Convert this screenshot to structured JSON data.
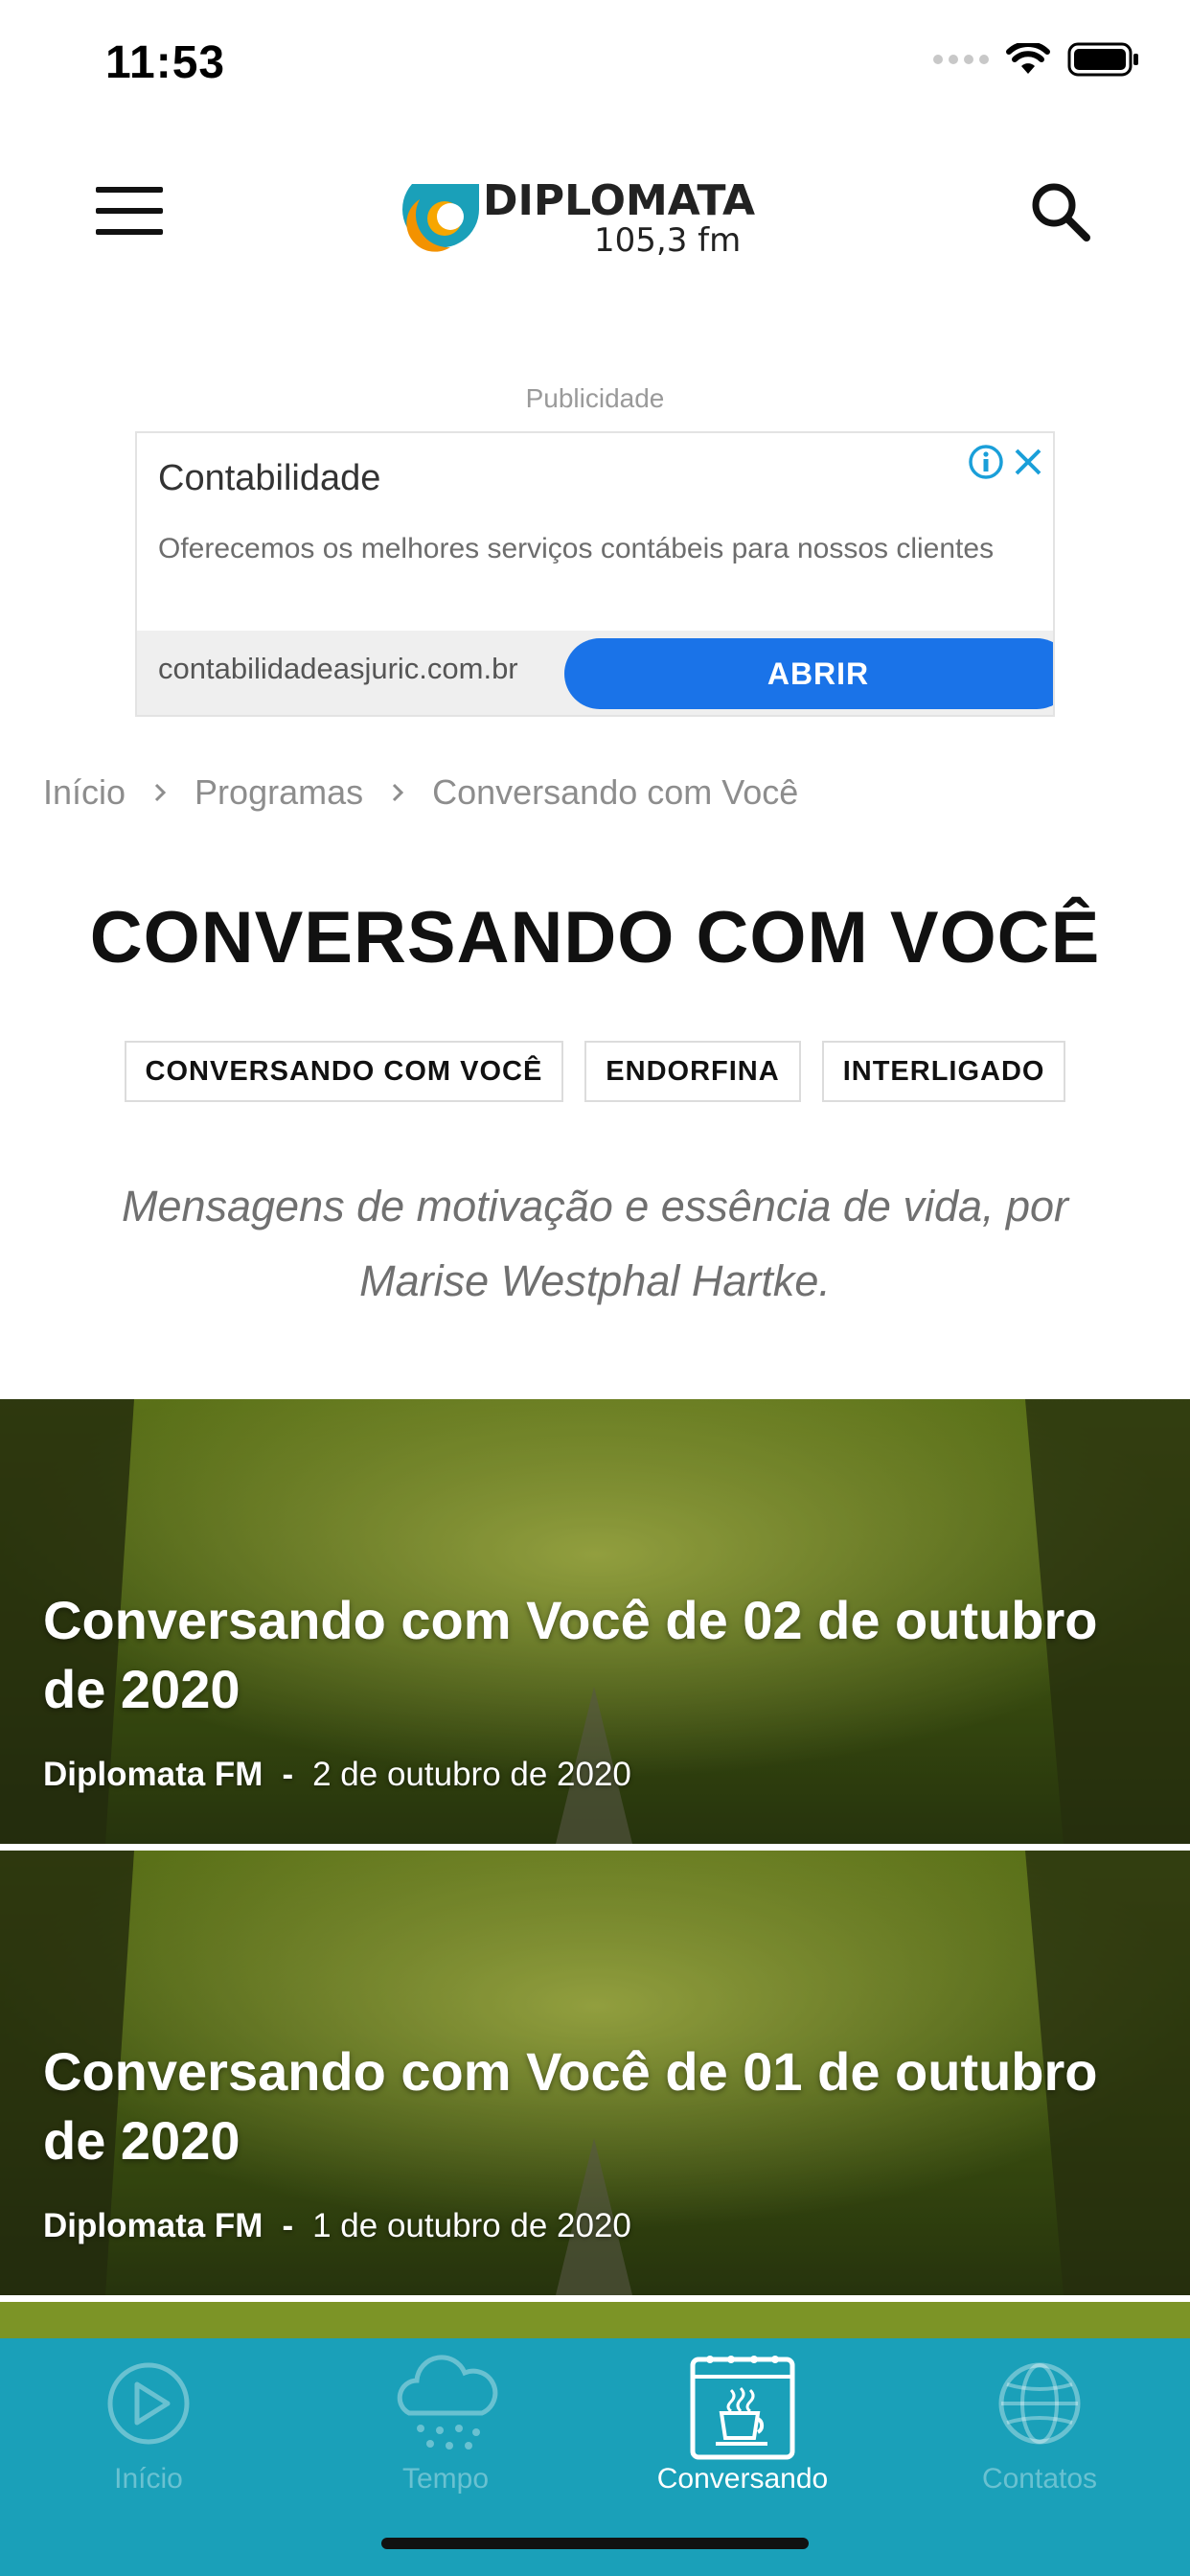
{
  "status_bar": {
    "time": "11:53"
  },
  "header": {
    "logo_text": "DIPLOMATA",
    "logo_subtext": "105,3 fm"
  },
  "ad": {
    "label": "Publicidade",
    "title": "Contabilidade",
    "description": "Oferecemos os melhores serviços contábeis para nossos clientes",
    "url": "contabilidadeasjuric.com.br",
    "cta": "ABRIR"
  },
  "breadcrumb": {
    "items": [
      "Início",
      "Programas",
      "Conversando com Você"
    ]
  },
  "page": {
    "title": "CONVERSANDO COM VOCÊ",
    "tags": [
      "CONVERSANDO COM VOCÊ",
      "ENDORFINA",
      "INTERLIGADO"
    ],
    "description": "Mensagens de motivação e essência de vida, por Marise Westphal Hartke."
  },
  "posts": [
    {
      "title": "Conversando com Você de 02 de outubro de 2020",
      "author": "Diplomata FM",
      "separator": "-",
      "date": "2 de outubro de 2020"
    },
    {
      "title": "Conversando com Você de 01 de outubro de 2020",
      "author": "Diplomata FM",
      "separator": "-",
      "date": "1 de outubro de 2020"
    }
  ],
  "bottom_nav": {
    "items": [
      {
        "label": "Início",
        "icon": "play-icon",
        "active": false
      },
      {
        "label": "Tempo",
        "icon": "weather-icon",
        "active": false
      },
      {
        "label": "Conversando",
        "icon": "calendar-coffee-icon",
        "active": true
      },
      {
        "label": "Contatos",
        "icon": "globe-icon",
        "active": false
      }
    ]
  },
  "colors": {
    "nav_bg": "#1aa0b9",
    "ad_button": "#1a73e8",
    "logo_orange": "#f39200",
    "logo_teal": "#1aa0b9"
  }
}
